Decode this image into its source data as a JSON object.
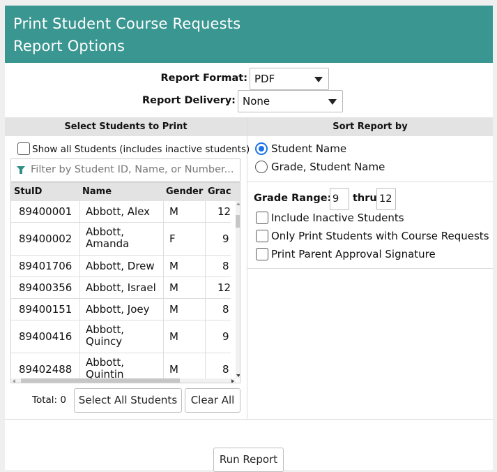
{
  "header": {
    "title_line1": "Print Student Course Requests",
    "title_line2": "Report Options"
  },
  "report_format": {
    "label": "Report Format:",
    "value": "PDF"
  },
  "report_delivery": {
    "label": "Report Delivery:",
    "value": "None"
  },
  "left_panel": {
    "title": "Select Students to Print",
    "show_all_label": "Show all Students (includes inactive students)",
    "show_all_checked": false,
    "filter_placeholder": "Filter by Student ID, Name, or Number...",
    "columns": [
      "StuID",
      "Name",
      "Gender",
      "Grade"
    ],
    "columns_shown": [
      "StuID",
      "Name",
      "Gender",
      "Grac"
    ],
    "rows": [
      {
        "id": "89400001",
        "name": "Abbott, Alex",
        "name2": "",
        "gender": "M",
        "grade": "12"
      },
      {
        "id": "89400002",
        "name": "Abbott,",
        "name2": "Amanda",
        "gender": "F",
        "grade": "9"
      },
      {
        "id": "89401706",
        "name": "Abbott, Drew",
        "name2": "",
        "gender": "M",
        "grade": "8"
      },
      {
        "id": "89400356",
        "name": "Abbott, Israel",
        "name2": "",
        "gender": "M",
        "grade": "12"
      },
      {
        "id": "89400151",
        "name": "Abbott, Joey",
        "name2": "",
        "gender": "M",
        "grade": "8"
      },
      {
        "id": "89400416",
        "name": "Abbott,",
        "name2": "Quincy",
        "gender": "M",
        "grade": "9"
      },
      {
        "id": "89402488",
        "name": "Abbott,",
        "name2": "Quintin",
        "gender": "M",
        "grade": "8"
      }
    ],
    "total_label": "Total: 0",
    "select_all_label": "Select All Students",
    "clear_all_label": "Clear All"
  },
  "right_panel": {
    "title": "Sort Report by",
    "sort_options": [
      {
        "label": "Student Name",
        "selected": true
      },
      {
        "label": "Grade, Student Name",
        "selected": false
      }
    ],
    "grade_range_label": "Grade Range:",
    "grade_from": "9",
    "thru_label": "thru",
    "grade_to": "12",
    "checkbox_options": [
      {
        "label": "Include Inactive Students",
        "checked": false
      },
      {
        "label": "Only Print Students with Course Requests",
        "checked": false
      },
      {
        "label": "Print Parent Approval Signature",
        "checked": false
      }
    ]
  },
  "footer": {
    "run_report_label": "Run Report"
  },
  "colors": {
    "header_bg": "#3a9690",
    "accent": "#1a73e8",
    "filter_icon": "#2e8f88"
  }
}
